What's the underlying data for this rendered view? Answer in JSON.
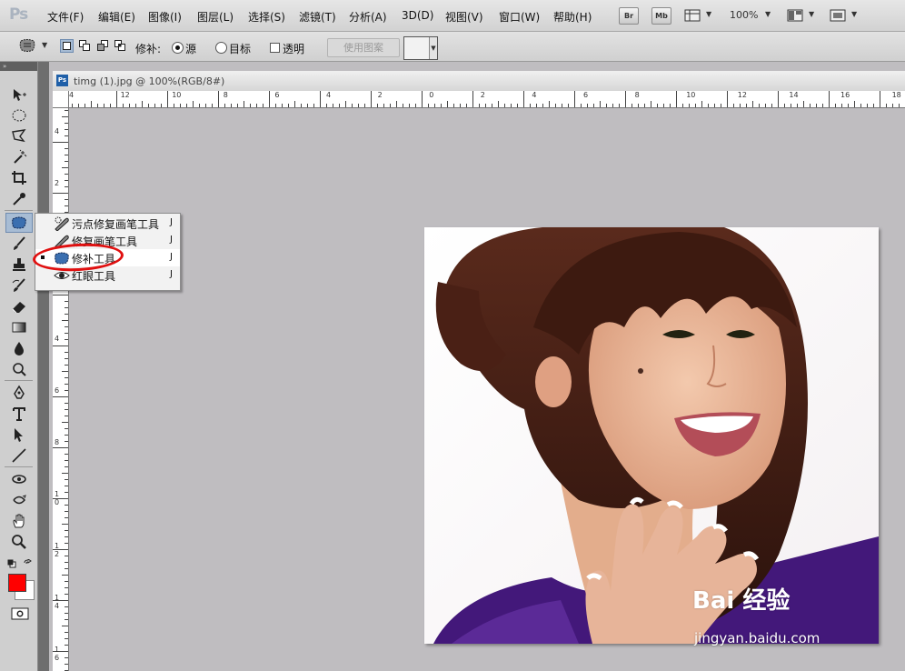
{
  "app": {
    "logo": "Ps"
  },
  "menubar": {
    "items": [
      "文件(F)",
      "编辑(E)",
      "图像(I)",
      "图层(L)",
      "选择(S)",
      "滤镜(T)",
      "分析(A)",
      "3D(D)",
      "视图(V)",
      "窗口(W)",
      "帮助(H)"
    ],
    "bridge_label": "Br",
    "minibridge_label": "Mb",
    "zoom": "100%"
  },
  "options_bar": {
    "patch_label": "修补:",
    "source_label": "源",
    "destination_label": "目标",
    "transparent_label": "透明",
    "use_pattern_label": "使用图案",
    "source_selected": true
  },
  "document": {
    "tab_title": "timg (1).jpg @ 100%(RGB/8#)",
    "badge": "Ps",
    "ruler_h_ticks": [
      "4",
      "12",
      "10",
      "8",
      "6",
      "4",
      "2",
      "0",
      "2",
      "4",
      "6",
      "8",
      "10",
      "12",
      "14",
      "16",
      "18"
    ],
    "ruler_v_ticks": [
      "4",
      "2",
      "0",
      "2",
      "4",
      "6",
      "8",
      "1\n0",
      "1\n2",
      "1\n4",
      "1\n6"
    ]
  },
  "tool_flyout": {
    "items": [
      {
        "label": "污点修复画笔工具",
        "shortcut": "J",
        "icon": "spot-healing-brush-icon",
        "selected": false
      },
      {
        "label": "修复画笔工具",
        "shortcut": "J",
        "icon": "healing-brush-icon",
        "selected": false
      },
      {
        "label": "修补工具",
        "shortcut": "J",
        "icon": "patch-tool-icon",
        "selected": true
      },
      {
        "label": "红眼工具",
        "shortcut": "J",
        "icon": "red-eye-icon",
        "selected": false
      }
    ]
  },
  "colors": {
    "foreground": "#ff0000",
    "background": "#ffffff",
    "highlight_ellipse": "#e01010"
  },
  "watermark": {
    "brand": "Bai 经验",
    "url": "jingyan.baidu.com"
  }
}
